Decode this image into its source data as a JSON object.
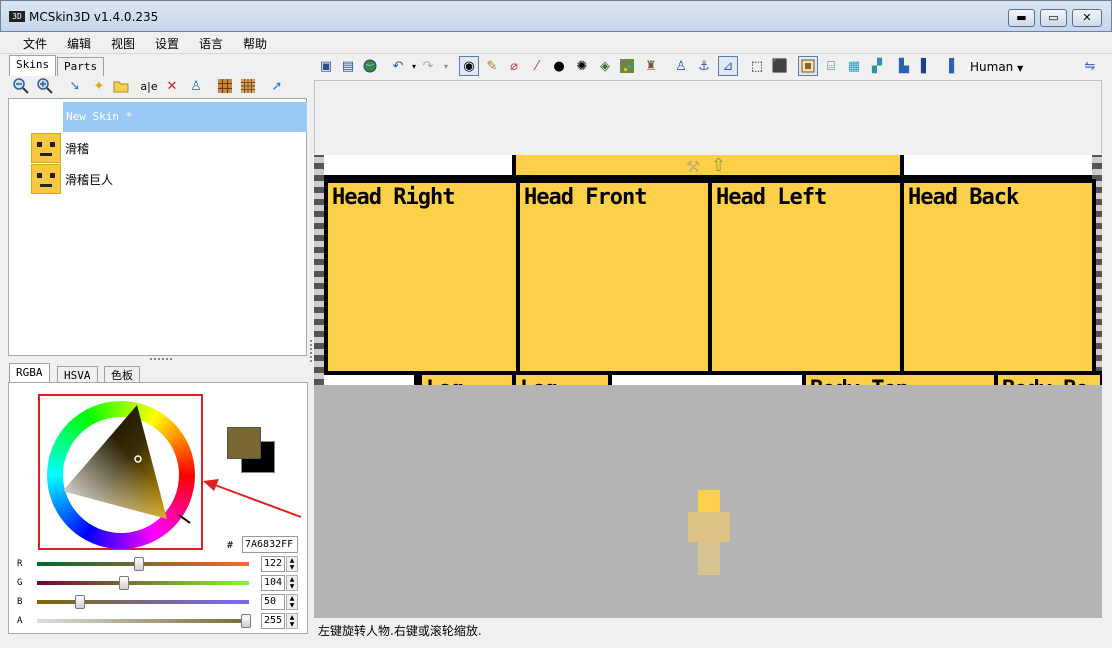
{
  "window": {
    "title": "MCSkin3D v1.4.0.235",
    "app_icon_text": "3D",
    "minimize_label": "▬",
    "maximize_label": "▭",
    "close_label": "✕"
  },
  "menu": [
    "文件",
    "编辑",
    "视图",
    "设置",
    "语言",
    "帮助"
  ],
  "left_tabs": {
    "skins": "Skins",
    "parts": "Parts"
  },
  "skins_list": {
    "new_skin": "New Skin *",
    "items": [
      "滑稽",
      "滑稽巨人"
    ]
  },
  "color_tabs": {
    "rgba": "RGBA",
    "hsva": "HSVA",
    "palette": "色板"
  },
  "color": {
    "hex_label": "#",
    "hex_value": "7A6832FF",
    "primary": "#7a6832",
    "secondary": "#000000",
    "channels": [
      {
        "label": "R",
        "value": "122"
      },
      {
        "label": "G",
        "value": "104"
      },
      {
        "label": "B",
        "value": "50"
      },
      {
        "label": "A",
        "value": "255"
      }
    ]
  },
  "toolbar": {
    "model_selector": "Human"
  },
  "uv_faces": {
    "head_right": "Head Right",
    "head_front": "Head Front",
    "head_left": "Head Left",
    "head_back": "Head Back",
    "leg_a": "Leg",
    "leg_b": "Leg",
    "body_top": "Body Top",
    "body_bottom": "Body Bo"
  },
  "status": "左键旋转人物.右键或滚轮缩放.",
  "colors": {
    "skin_face": "#fdd049",
    "accent_red": "#e02020"
  }
}
